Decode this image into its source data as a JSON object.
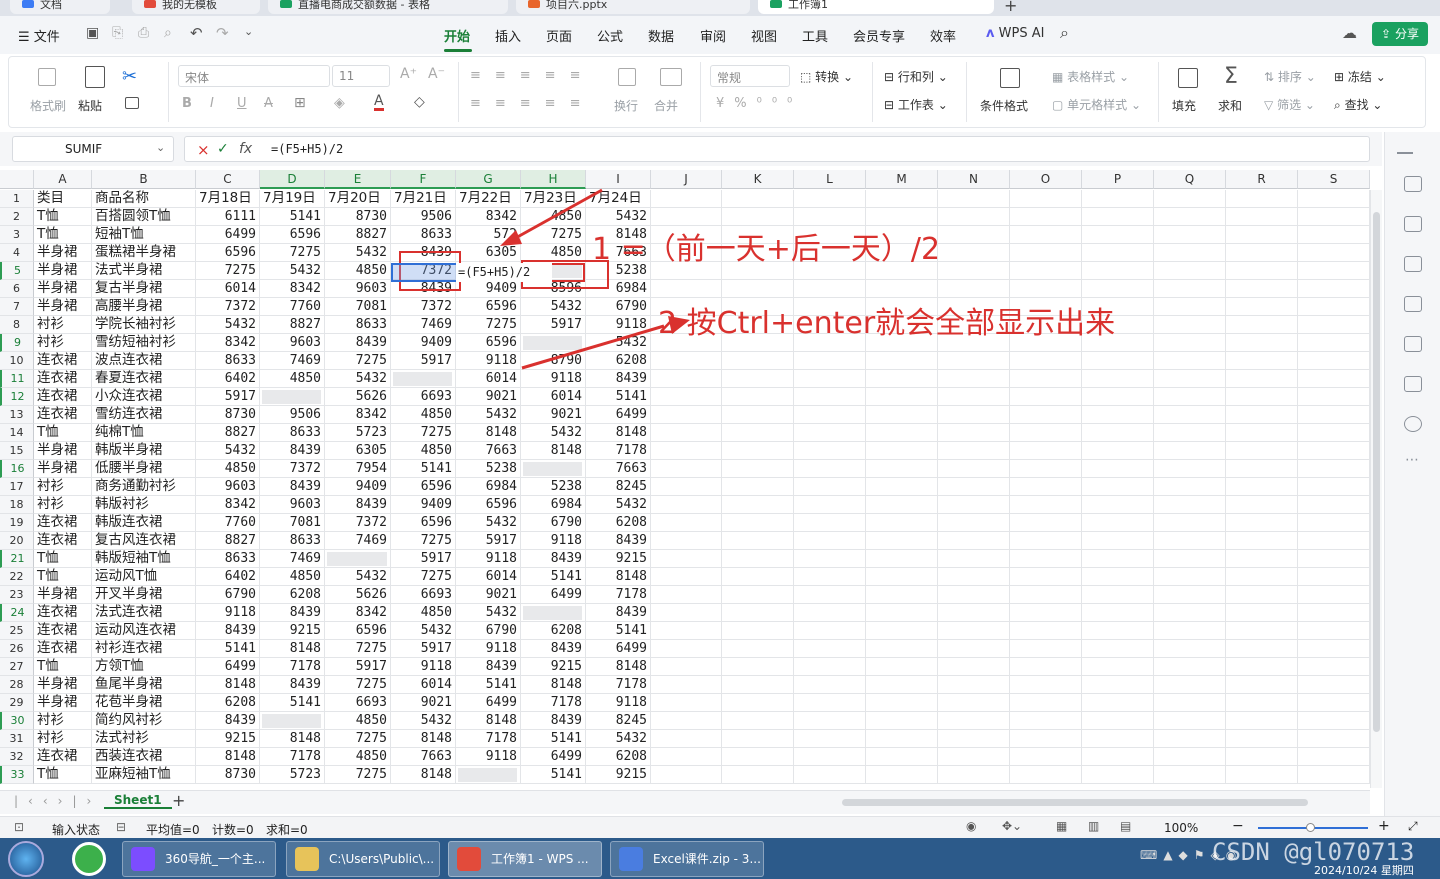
{
  "file_tabs": [
    {
      "label": "文档",
      "icon_color": "#3d7cf4"
    },
    {
      "label": "我的无模板",
      "icon_color": "#e24b3b"
    },
    {
      "label": "直播电商成交额数据 - 表格",
      "icon_color": "#1aa160"
    },
    {
      "label": "项目六.pptx",
      "icon_color": "#e8652b"
    },
    {
      "label": "工作簿1",
      "icon_color": "#1aa160"
    }
  ],
  "menu": {
    "file_label": "文件",
    "tabs": [
      "开始",
      "插入",
      "页面",
      "公式",
      "数据",
      "审阅",
      "视图",
      "工具",
      "会员专享",
      "效率"
    ],
    "active_tab": "开始",
    "wps_ai": "WPS AI",
    "share": "分享"
  },
  "ribbon": {
    "format_painter": "格式刷",
    "paste": "粘贴",
    "font_name": "宋体",
    "font_size": "11",
    "wrap": "换行",
    "merge": "合并",
    "number_format": "常规",
    "convert": "转换",
    "row_col": "行和列",
    "worksheet": "工作表",
    "conditional": "条件格式",
    "table_style": "表格样式",
    "cell_style": "单元格样式",
    "fill": "填充",
    "sum": "求和",
    "sort": "排序",
    "filter": "筛选",
    "freeze": "冻结",
    "find": "查找"
  },
  "formula_bar": {
    "name_box": "SUMIF",
    "formula": "=(F5+H5)/2"
  },
  "columns": [
    "A",
    "B",
    "C",
    "D",
    "E",
    "F",
    "G",
    "H",
    "I",
    "J",
    "K",
    "L",
    "M",
    "N",
    "O",
    "P",
    "Q",
    "R",
    "S"
  ],
  "header_row": [
    "类目",
    "商品名称",
    "7月18日",
    "7月19日",
    "7月20日",
    "7月21日",
    "7月22日",
    "7月23日",
    "7月24日"
  ],
  "rows": [
    {
      "r": "2",
      "cat": "T恤",
      "name": "百搭圆领T恤",
      "v": [
        "6111",
        "5141",
        "8730",
        "9506",
        "8342",
        "4850",
        "5432"
      ]
    },
    {
      "r": "3",
      "cat": "T恤",
      "name": "短袖T恤",
      "v": [
        "6499",
        "6596",
        "8827",
        "8633",
        "572",
        "7275",
        "8148"
      ]
    },
    {
      "r": "4",
      "cat": "半身裙",
      "name": "蛋糕裙半身裙",
      "v": [
        "6596",
        "7275",
        "5432",
        "8439",
        "6305",
        "4850",
        "7663"
      ]
    },
    {
      "r": "5",
      "cat": "半身裙",
      "name": "法式半身裙",
      "v": [
        "7275",
        "5432",
        "4850",
        "7372",
        "",
        "",
        "5238"
      ]
    },
    {
      "r": "6",
      "cat": "半身裙",
      "name": "复古半身裙",
      "v": [
        "6014",
        "8342",
        "9603",
        "8439",
        "9409",
        "8596",
        "6984"
      ]
    },
    {
      "r": "7",
      "cat": "半身裙",
      "name": "高腰半身裙",
      "v": [
        "7372",
        "7760",
        "7081",
        "7372",
        "6596",
        "5432",
        "6790"
      ]
    },
    {
      "r": "8",
      "cat": "衬衫",
      "name": "学院长袖衬衫",
      "v": [
        "5432",
        "8827",
        "8633",
        "7469",
        "7275",
        "5917",
        "9118"
      ]
    },
    {
      "r": "9",
      "cat": "衬衫",
      "name": "雪纺短袖衬衫",
      "v": [
        "8342",
        "9603",
        "8439",
        "9409",
        "6596",
        "",
        "5432"
      ]
    },
    {
      "r": "10",
      "cat": "连衣裙",
      "name": "波点连衣裙",
      "v": [
        "8633",
        "7469",
        "7275",
        "5917",
        "9118",
        "8790",
        "6208"
      ]
    },
    {
      "r": "11",
      "cat": "连衣裙",
      "name": "春夏连衣裙",
      "v": [
        "6402",
        "4850",
        "5432",
        "",
        "6014",
        "9118",
        "8439"
      ]
    },
    {
      "r": "12",
      "cat": "连衣裙",
      "name": "小众连衣裙",
      "v": [
        "5917",
        "",
        "5626",
        "6693",
        "9021",
        "6014",
        "5141"
      ]
    },
    {
      "r": "13",
      "cat": "连衣裙",
      "name": "雪纺连衣裙",
      "v": [
        "8730",
        "9506",
        "8342",
        "4850",
        "5432",
        "9021",
        "6499"
      ]
    },
    {
      "r": "14",
      "cat": "T恤",
      "name": "纯棉T恤",
      "v": [
        "8827",
        "8633",
        "5723",
        "7275",
        "8148",
        "5432",
        "8148"
      ]
    },
    {
      "r": "15",
      "cat": "半身裙",
      "name": "韩版半身裙",
      "v": [
        "5432",
        "8439",
        "6305",
        "4850",
        "7663",
        "8148",
        "7178"
      ]
    },
    {
      "r": "16",
      "cat": "半身裙",
      "name": "低腰半身裙",
      "v": [
        "4850",
        "7372",
        "7954",
        "5141",
        "5238",
        "",
        "7663"
      ]
    },
    {
      "r": "17",
      "cat": "衬衫",
      "name": "商务通勤衬衫",
      "v": [
        "9603",
        "8439",
        "9409",
        "6596",
        "6984",
        "5238",
        "8245"
      ]
    },
    {
      "r": "18",
      "cat": "衬衫",
      "name": "韩版衬衫",
      "v": [
        "8342",
        "9603",
        "8439",
        "9409",
        "6596",
        "6984",
        "5432"
      ]
    },
    {
      "r": "19",
      "cat": "连衣裙",
      "name": "韩版连衣裙",
      "v": [
        "7760",
        "7081",
        "7372",
        "6596",
        "5432",
        "6790",
        "6208"
      ]
    },
    {
      "r": "20",
      "cat": "连衣裙",
      "name": "复古风连衣裙",
      "v": [
        "8827",
        "8633",
        "7469",
        "7275",
        "5917",
        "9118",
        "8439"
      ]
    },
    {
      "r": "21",
      "cat": "T恤",
      "name": "韩版短袖T恤",
      "v": [
        "8633",
        "7469",
        "",
        "5917",
        "9118",
        "8439",
        "9215"
      ]
    },
    {
      "r": "22",
      "cat": "T恤",
      "name": "运动风T恤",
      "v": [
        "6402",
        "4850",
        "5432",
        "7275",
        "6014",
        "5141",
        "8148"
      ]
    },
    {
      "r": "23",
      "cat": "半身裙",
      "name": "开叉半身裙",
      "v": [
        "6790",
        "6208",
        "5626",
        "6693",
        "9021",
        "6499",
        "7178"
      ]
    },
    {
      "r": "24",
      "cat": "连衣裙",
      "name": "法式连衣裙",
      "v": [
        "9118",
        "8439",
        "8342",
        "4850",
        "5432",
        "",
        "8439"
      ]
    },
    {
      "r": "25",
      "cat": "连衣裙",
      "name": "运动风连衣裙",
      "v": [
        "8439",
        "9215",
        "6596",
        "5432",
        "6790",
        "6208",
        "5141"
      ]
    },
    {
      "r": "26",
      "cat": "连衣裙",
      "name": "衬衫连衣裙",
      "v": [
        "5141",
        "8148",
        "7275",
        "5917",
        "9118",
        "8439",
        "6499"
      ]
    },
    {
      "r": "27",
      "cat": "T恤",
      "name": "方领T恤",
      "v": [
        "6499",
        "7178",
        "5917",
        "9118",
        "8439",
        "9215",
        "8148"
      ]
    },
    {
      "r": "28",
      "cat": "半身裙",
      "name": "鱼尾半身裙",
      "v": [
        "8148",
        "8439",
        "7275",
        "6014",
        "5141",
        "8148",
        "7178"
      ]
    },
    {
      "r": "29",
      "cat": "半身裙",
      "name": "花苞半身裙",
      "v": [
        "6208",
        "5141",
        "6693",
        "9021",
        "6499",
        "7178",
        "9118"
      ]
    },
    {
      "r": "30",
      "cat": "衬衫",
      "name": "简约风衬衫",
      "v": [
        "8439",
        "",
        "4850",
        "5432",
        "8148",
        "8439",
        "8245"
      ]
    },
    {
      "r": "31",
      "cat": "衬衫",
      "name": "法式衬衫",
      "v": [
        "9215",
        "8148",
        "7275",
        "8148",
        "7178",
        "5141",
        "5432"
      ]
    },
    {
      "r": "32",
      "cat": "连衣裙",
      "name": "西装连衣裙",
      "v": [
        "8148",
        "7178",
        "4850",
        "7663",
        "9118",
        "6499",
        "6208"
      ]
    },
    {
      "r": "33",
      "cat": "T恤",
      "name": "亚麻短袖T恤",
      "v": [
        "8730",
        "5723",
        "7275",
        "8148",
        "",
        "5141",
        "9215"
      ]
    }
  ],
  "g5_formula_overlay": "=(F5+H5)/2",
  "annotations": {
    "note1": "1 =（前一天+后一天）/2",
    "note2": "2  按Ctrl+enter就会全部显示出来"
  },
  "sheet_tab": "Sheet1",
  "status": {
    "mode": "输入状态",
    "average": "平均值=0",
    "count": "计数=0",
    "sum": "求和=0",
    "zoom": "100%"
  },
  "taskbar": {
    "apps": [
      "360导航_一个主...",
      "C:\\Users\\Public\\...",
      "工作簿1 - WPS ...",
      "Excel课件.zip - 3..."
    ],
    "datetime": "2024/10/24 星期四",
    "watermark": "CSDN @gl070713"
  },
  "colors": {
    "accent": "#1a7f37",
    "annotation": "#d9312e",
    "taskbar": "#2c5a8a"
  }
}
